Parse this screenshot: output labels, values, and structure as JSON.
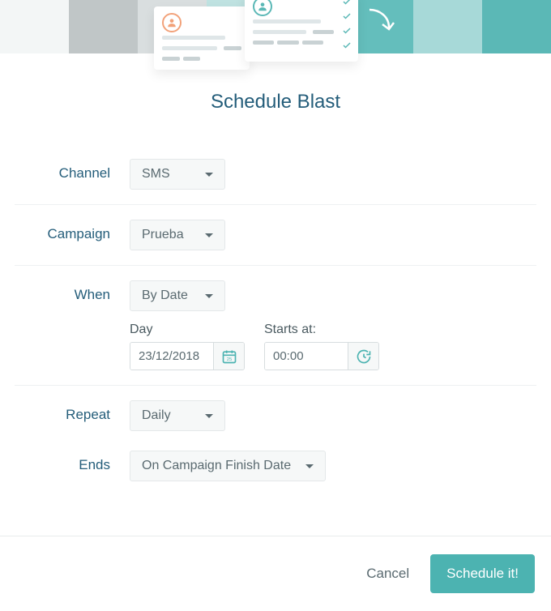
{
  "title": "Schedule Blast",
  "labels": {
    "channel": "Channel",
    "campaign": "Campaign",
    "when": "When",
    "day": "Day",
    "starts_at": "Starts at:",
    "repeat": "Repeat",
    "ends": "Ends"
  },
  "values": {
    "channel": "SMS",
    "campaign": "Prueba",
    "when": "By Date",
    "day": "23/12/2018",
    "starts_at": "00:00",
    "repeat": "Daily",
    "ends": "On Campaign Finish Date"
  },
  "buttons": {
    "cancel": "Cancel",
    "submit": "Schedule it!"
  },
  "colors": {
    "brand_text": "#245d7a",
    "accent": "#4cb3b1",
    "muted_text": "#5a6a70"
  }
}
